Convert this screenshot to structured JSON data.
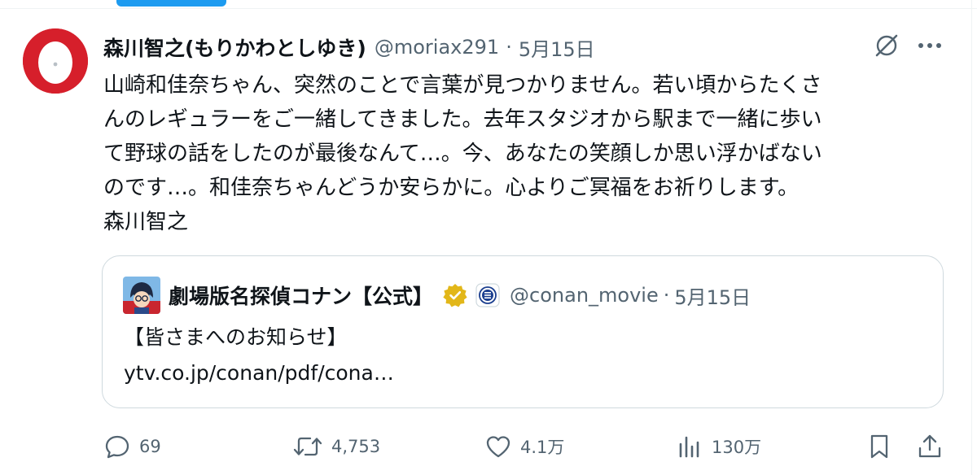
{
  "tweet": {
    "author": {
      "display_name": "森川智之(もりかわとしゆき)",
      "handle": "@moriax291",
      "date": "5月15日"
    },
    "separator": "·",
    "text_lines": [
      "山崎和佳奈ちゃん、突然のことで言葉が見つかりません。若い頃からたくさ",
      "んのレギュラーをご一緒してきました。去年スタジオから駅まで一緒に歩い",
      "て野球の話をしたのが最後なんて…。今、あなたの笑顔しか思い浮かばない",
      "のです…。和佳奈ちゃんどうか安らかに。心よりご冥福をお祈りします。",
      "森川智之"
    ],
    "quote": {
      "display_name": "劇場版名探偵コナン【公式】",
      "handle": "@conan_movie",
      "date": "5月15日",
      "text_lines": [
        "【皆さまへのお知らせ】",
        "ytv.co.jp/conan/pdf/cona…"
      ]
    },
    "actions": {
      "replies": "69",
      "reposts": "4,753",
      "likes": "4.1万",
      "views": "130万"
    }
  },
  "colors": {
    "accent": "#1d9bf0",
    "text": "#0f1419",
    "secondary": "#536471",
    "border": "#cfd9de",
    "avatar_red": "#d61f2b",
    "verified_gold": "#e2b719"
  },
  "icons": {
    "grok": "grok-icon",
    "more": "more-icon",
    "reply": "reply-icon",
    "repost": "repost-icon",
    "like": "heart-icon",
    "views": "views-icon",
    "bookmark": "bookmark-icon",
    "share": "share-icon",
    "verified": "verified-badge-icon",
    "affiliate": "affiliate-badge-icon"
  }
}
